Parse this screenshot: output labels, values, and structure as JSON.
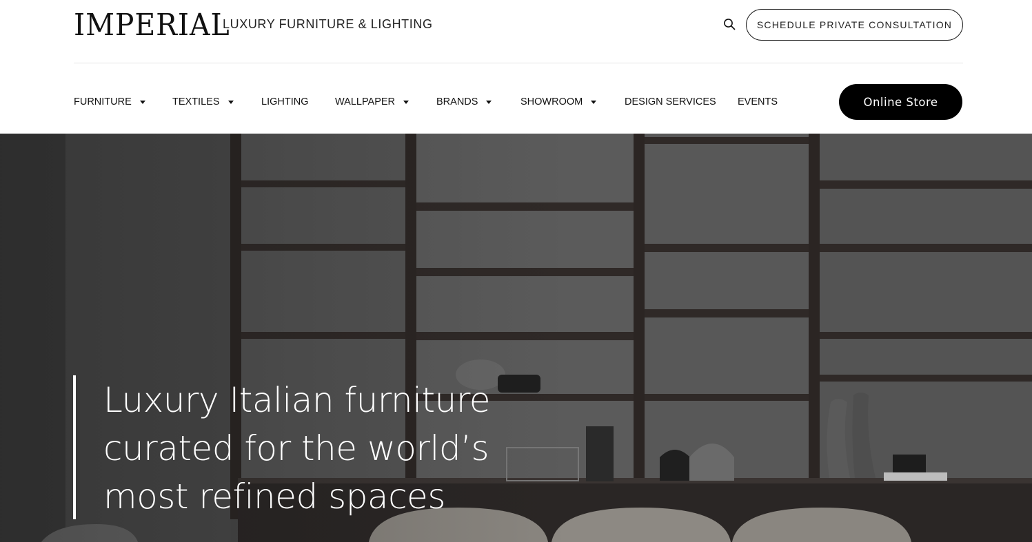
{
  "header": {
    "logo_text": "IMPERIAL",
    "tagline": "LUXURY FURNITURE & LIGHTING",
    "search_icon": "search-icon",
    "consult_label": "SCHEDULE PRIVATE CONSULTATION"
  },
  "nav": {
    "items": [
      {
        "label": "FURNITURE",
        "has_dropdown": true
      },
      {
        "label": "TEXTILES",
        "has_dropdown": true
      },
      {
        "label": "LIGHTING",
        "has_dropdown": false
      },
      {
        "label": "WALLPAPER",
        "has_dropdown": true
      },
      {
        "label": "BRANDS",
        "has_dropdown": true
      },
      {
        "label": "SHOWROOM",
        "has_dropdown": true
      },
      {
        "label": "DESIGN SERVICES",
        "has_dropdown": false
      },
      {
        "label": "EVENTS",
        "has_dropdown": false
      }
    ],
    "store_label": "Online Store"
  },
  "hero": {
    "title_lines": [
      "Luxury Italian furniture",
      "curated for the world’s",
      "most refined spaces"
    ]
  },
  "colors": {
    "primary": "#000000",
    "text": "#111111",
    "hero_text": "#ffffff"
  }
}
